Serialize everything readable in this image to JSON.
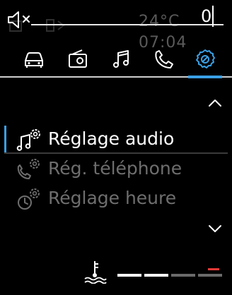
{
  "status_bar": {
    "volume_value": "0",
    "ghost_clock_text": "24°C 07:04",
    "muted": true
  },
  "tabs": [
    {
      "id": "car",
      "icon": "car-icon",
      "active": false
    },
    {
      "id": "media",
      "icon": "radio-icon",
      "active": false
    },
    {
      "id": "music",
      "icon": "music-note-icon",
      "active": false
    },
    {
      "id": "phone",
      "icon": "phone-icon",
      "active": false
    },
    {
      "id": "settings",
      "icon": "gear-icon",
      "active": true
    }
  ],
  "menu": {
    "items": [
      {
        "label": "Réglage audio",
        "icon": "audio-settings-icon",
        "selected": true
      },
      {
        "label": "Rég. téléphone",
        "icon": "phone-settings-icon",
        "selected": false
      },
      {
        "label": "Réglage heure",
        "icon": "clock-settings-icon",
        "selected": false
      }
    ]
  },
  "coolant_gauge": {
    "icon": "coolant-temperature-icon",
    "segments_lit": 2,
    "segments_total": 4,
    "level_fraction": 0.5,
    "colors": {
      "lit": "#ffffff",
      "dim": "#6a6a6a",
      "warning": "#e53935"
    }
  },
  "colors": {
    "accent": "#3aa0e6",
    "text_primary": "#ffffff",
    "text_dim": "#6e6e6e",
    "background": "#000000"
  }
}
